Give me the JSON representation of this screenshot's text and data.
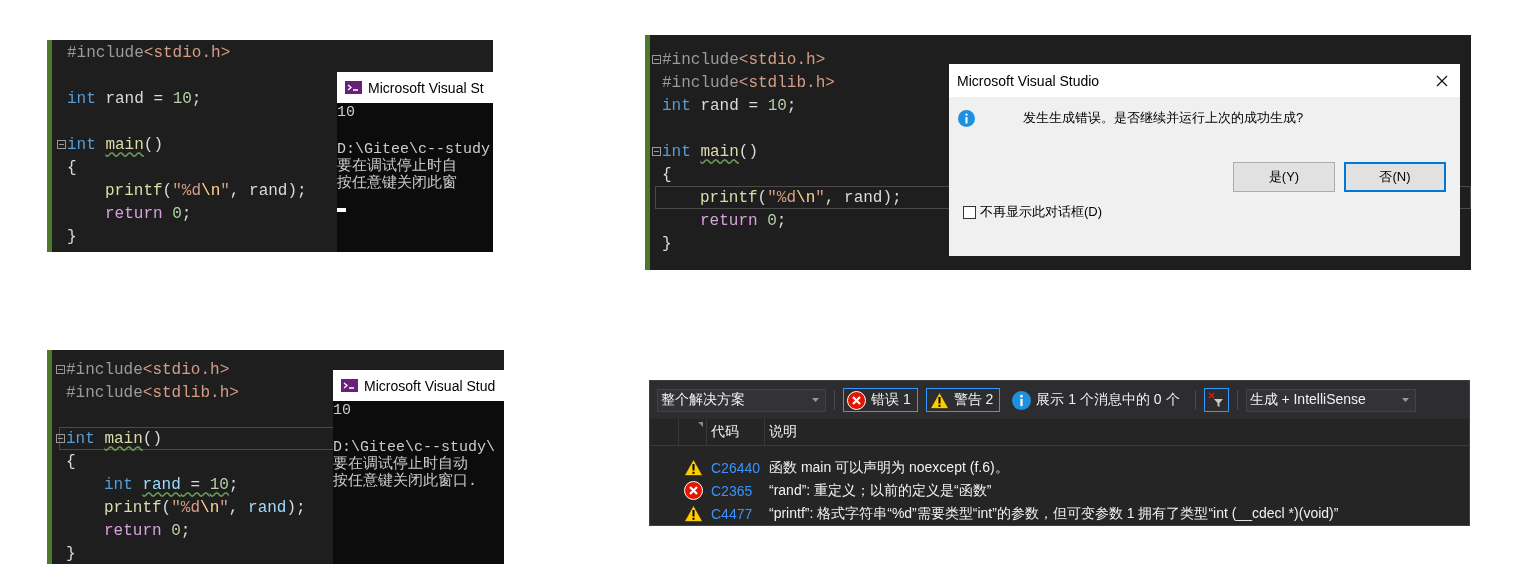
{
  "panels": [
    {
      "kind": "editor-console",
      "lines": [
        {
          "kind": "code",
          "current": false,
          "tokens": [
            {
              "text": "#include",
              "kind": "preproc",
              "wavy": false
            },
            {
              "text": "<stdio.h>",
              "kind": "header",
              "wavy": false
            }
          ]
        },
        {
          "kind": "blank"
        },
        {
          "kind": "code",
          "current": false,
          "tokens": [
            {
              "text": "int",
              "kind": "keyword",
              "wavy": false
            },
            {
              "text": " rand = ",
              "kind": "plain",
              "wavy": false
            },
            {
              "text": "10",
              "kind": "number",
              "wavy": false
            },
            {
              "text": ";",
              "kind": "plain",
              "wavy": false
            }
          ]
        },
        {
          "kind": "blank"
        },
        {
          "kind": "fold",
          "current": false,
          "tokens": [
            {
              "text": "int ",
              "kind": "keyword",
              "wavy": false
            },
            {
              "text": "main",
              "kind": "func",
              "wavy": true
            },
            {
              "text": "()",
              "kind": "plain",
              "wavy": false
            }
          ]
        },
        {
          "kind": "code",
          "current": false,
          "tokens": [
            {
              "text": "{",
              "kind": "plain",
              "wavy": false
            }
          ],
          "children": [
            {
              "kind": "code",
              "current": false,
              "tokens": [
                {
                  "text": "printf",
                  "kind": "func",
                  "wavy": false
                },
                {
                  "text": "(",
                  "kind": "plain",
                  "wavy": false
                },
                {
                  "text": "\"%d",
                  "kind": "string",
                  "wavy": false
                },
                {
                  "text": "\\n",
                  "kind": "escape",
                  "wavy": false
                },
                {
                  "text": "\"",
                  "kind": "string",
                  "wavy": false
                },
                {
                  "text": ", rand);",
                  "kind": "plain",
                  "wavy": false
                }
              ]
            },
            {
              "kind": "code",
              "current": false,
              "tokens": [
                {
                  "text": "return ",
                  "kind": "control",
                  "wavy": false
                },
                {
                  "text": "0",
                  "kind": "number",
                  "wavy": false
                },
                {
                  "text": ";",
                  "kind": "plain",
                  "wavy": false
                }
              ]
            }
          ]
        },
        {
          "kind": "code",
          "current": false,
          "tokens": [
            {
              "text": "}",
              "kind": "plain",
              "wavy": false
            }
          ]
        }
      ],
      "console": {
        "title": "Microsoft Visual St",
        "output": [
          "10"
        ],
        "messages": [
          "D:\\Gitee\\c--study",
          "要在调试停止时自",
          "按任意键关闭此窗"
        ],
        "cursor": true
      }
    },
    {
      "kind": "editor-dialog",
      "lines": [
        {
          "kind": "fold",
          "current": false,
          "tokens": [
            {
              "text": "#include",
              "kind": "preproc",
              "wavy": false
            },
            {
              "text": "<stdio.h>",
              "kind": "header",
              "wavy": false
            }
          ]
        },
        {
          "kind": "code",
          "current": false,
          "tokens": [
            {
              "text": "#include",
              "kind": "preproc",
              "wavy": false
            },
            {
              "text": "<stdlib.h>",
              "kind": "header",
              "wavy": false
            }
          ]
        },
        {
          "kind": "code",
          "current": false,
          "tokens": [
            {
              "text": "int",
              "kind": "keyword",
              "wavy": false
            },
            {
              "text": " rand = ",
              "kind": "plain",
              "wavy": false
            },
            {
              "text": "10",
              "kind": "number",
              "wavy": false
            },
            {
              "text": ";",
              "kind": "plain",
              "wavy": false
            }
          ]
        },
        {
          "kind": "blank"
        },
        {
          "kind": "fold",
          "current": false,
          "tokens": [
            {
              "text": "int ",
              "kind": "keyword",
              "wavy": false
            },
            {
              "text": "main",
              "kind": "func",
              "wavy": true
            },
            {
              "text": "()",
              "kind": "plain",
              "wavy": false
            }
          ]
        },
        {
          "kind": "code",
          "current": false,
          "tokens": [
            {
              "text": "{",
              "kind": "plain",
              "wavy": false
            }
          ],
          "children": [
            {
              "kind": "code",
              "current": true,
              "tokens": [
                {
                  "text": "printf",
                  "kind": "func",
                  "wavy": false
                },
                {
                  "text": "(",
                  "kind": "plain",
                  "wavy": false
                },
                {
                  "text": "\"%d",
                  "kind": "string",
                  "wavy": false
                },
                {
                  "text": "\\n",
                  "kind": "escape",
                  "wavy": false
                },
                {
                  "text": "\"",
                  "kind": "string",
                  "wavy": false
                },
                {
                  "text": ", rand);",
                  "kind": "plain",
                  "wavy": false
                }
              ]
            },
            {
              "kind": "code",
              "current": false,
              "tokens": [
                {
                  "text": "return ",
                  "kind": "control",
                  "wavy": false
                },
                {
                  "text": "0",
                  "kind": "number",
                  "wavy": false
                },
                {
                  "text": ";",
                  "kind": "plain",
                  "wavy": false
                }
              ]
            }
          ]
        },
        {
          "kind": "code",
          "current": false,
          "tokens": [
            {
              "text": "}",
              "kind": "plain",
              "wavy": false
            }
          ]
        }
      ],
      "dialog": {
        "title": "Microsoft Visual Studio",
        "message": "发生生成错误。是否继续并运行上次的成功生成?",
        "buttons": [
          {
            "label": "是(Y)",
            "focused": false
          },
          {
            "label": "否(N)",
            "focused": true
          }
        ],
        "checkbox": {
          "label": "不再显示此对话框(D)",
          "checked": false
        }
      }
    },
    {
      "kind": "editor-console",
      "lines": [
        {
          "kind": "fold",
          "current": false,
          "tokens": [
            {
              "text": "#include",
              "kind": "preproc",
              "wavy": false
            },
            {
              "text": "<stdio.h>",
              "kind": "header",
              "wavy": false
            }
          ]
        },
        {
          "kind": "code",
          "current": false,
          "tokens": [
            {
              "text": "#include",
              "kind": "preproc",
              "wavy": false
            },
            {
              "text": "<stdlib.h>",
              "kind": "header",
              "wavy": false
            }
          ]
        },
        {
          "kind": "blank"
        },
        {
          "kind": "fold",
          "current": true,
          "tokens": [
            {
              "text": "int ",
              "kind": "keyword",
              "wavy": false
            },
            {
              "text": "main",
              "kind": "func",
              "wavy": true
            },
            {
              "text": "()",
              "kind": "plain",
              "wavy": false
            }
          ]
        },
        {
          "kind": "code",
          "current": false,
          "tokens": [
            {
              "text": "{",
              "kind": "plain",
              "wavy": false
            }
          ],
          "children": [
            {
              "kind": "code",
              "current": false,
              "tokens": [
                {
                  "text": "int ",
                  "kind": "keyword",
                  "wavy": false
                },
                {
                  "text": "rand",
                  "kind": "var",
                  "wavy": true
                },
                {
                  "text": " = ",
                  "kind": "plain",
                  "wavy": true
                },
                {
                  "text": "10",
                  "kind": "number",
                  "wavy": true
                },
                {
                  "text": ";",
                  "kind": "plain",
                  "wavy": false
                }
              ]
            },
            {
              "kind": "code",
              "current": false,
              "tokens": [
                {
                  "text": "printf",
                  "kind": "func",
                  "wavy": false
                },
                {
                  "text": "(",
                  "kind": "plain",
                  "wavy": false
                },
                {
                  "text": "\"%d",
                  "kind": "string",
                  "wavy": false
                },
                {
                  "text": "\\n",
                  "kind": "escape",
                  "wavy": false
                },
                {
                  "text": "\"",
                  "kind": "string",
                  "wavy": false
                },
                {
                  "text": ", ",
                  "kind": "plain",
                  "wavy": false
                },
                {
                  "text": "rand",
                  "kind": "var",
                  "wavy": false
                },
                {
                  "text": ");",
                  "kind": "plain",
                  "wavy": false
                }
              ]
            },
            {
              "kind": "code",
              "current": false,
              "tokens": [
                {
                  "text": "return ",
                  "kind": "control",
                  "wavy": false
                },
                {
                  "text": "0",
                  "kind": "number",
                  "wavy": false
                },
                {
                  "text": ";",
                  "kind": "plain",
                  "wavy": false
                }
              ]
            }
          ]
        },
        {
          "kind": "code",
          "current": false,
          "tokens": [
            {
              "text": "}",
              "kind": "plain",
              "wavy": false
            }
          ]
        }
      ],
      "console": {
        "title": "Microsoft Visual Stud",
        "output": [
          "10"
        ],
        "messages": [
          "D:\\Gitee\\c--study\\",
          "要在调试停止时自动",
          "按任意键关闭此窗口."
        ],
        "cursor": false
      }
    },
    {
      "kind": "error-list",
      "scope": "整个解决方案",
      "filters": [
        {
          "kind": "error",
          "label": "错误 1",
          "selected": true
        },
        {
          "kind": "warning",
          "label": "警告 2",
          "selected": true
        },
        {
          "kind": "info",
          "label": "展示 1 个消息中的 0 个",
          "selected": false
        }
      ],
      "clear_filter_selected": true,
      "source": "生成 + IntelliSense",
      "columns": [
        "代码",
        "说明"
      ],
      "rows": [
        {
          "kind": "warning",
          "code": "C26440",
          "description": "函数 main 可以声明为 noexcept (f.6)。"
        },
        {
          "kind": "error",
          "code": "C2365",
          "description": "“rand”: 重定义；以前的定义是“函数”"
        },
        {
          "kind": "warning",
          "code": "C4477",
          "description": "“printf”: 格式字符串“%d”需要类型“int”的参数，但可变参数 1 拥有了类型“int (__cdecl *)(void)”"
        }
      ]
    }
  ]
}
